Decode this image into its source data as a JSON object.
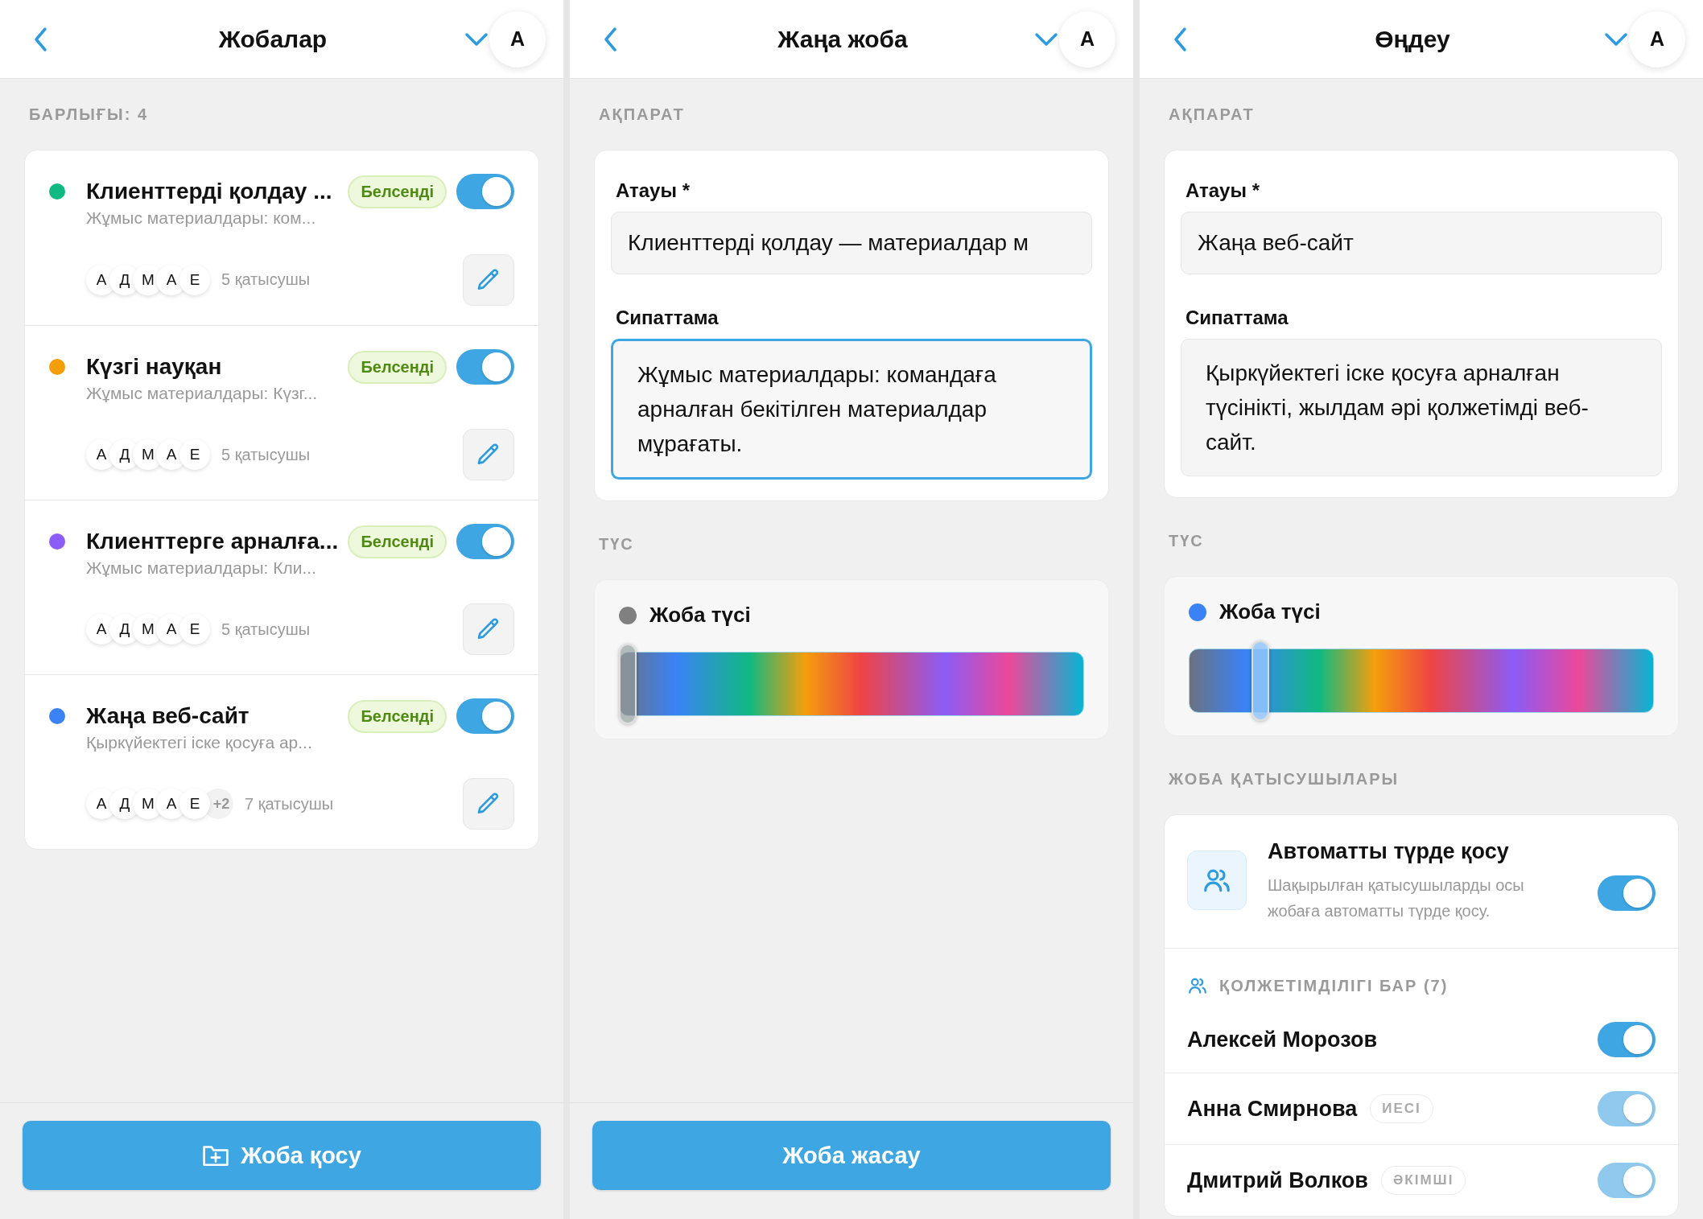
{
  "screens": [
    {
      "kind": "list",
      "header": {
        "title": "Жобалар",
        "avatar": "А"
      },
      "section_label": "БАРЛЫҒЫ: 4",
      "projects": [
        {
          "color": "#10b981",
          "title": "Клиенттерді қолдау ...",
          "description": "Жұмыс материалдары: ком...",
          "status": "Белсенді",
          "on": true,
          "avatars": [
            "А",
            "Д",
            "М",
            "А",
            "Е"
          ],
          "participants": "5 қатысушы"
        },
        {
          "color": "#f59e0b",
          "title": "Күзгі науқан",
          "description": "Жұмыс материалдары: Күзг...",
          "status": "Белсенді",
          "on": true,
          "avatars": [
            "А",
            "Д",
            "М",
            "А",
            "Е"
          ],
          "participants": "5 қатысушы"
        },
        {
          "color": "#8b5cf6",
          "title": "Клиенттерге арналға...",
          "description": "Жұмыс материалдары: Кли...",
          "status": "Белсенді",
          "on": true,
          "avatars": [
            "А",
            "Д",
            "М",
            "А",
            "Е"
          ],
          "participants": "5 қатысушы"
        },
        {
          "color": "#3b82f6",
          "title": "Жаңа веб-сайт",
          "description": "Қыркүйектегі іске қосуға ар...",
          "status": "Белсенді",
          "on": true,
          "avatars": [
            "А",
            "Д",
            "М",
            "А",
            "Е"
          ],
          "extra": "+2",
          "participants": "7 қатысушы"
        }
      ],
      "button": "Жоба қосу"
    },
    {
      "kind": "form",
      "header": {
        "title": "Жаңа жоба",
        "avatar": "А"
      },
      "info_label": "АҚПАРАТ",
      "fields": [
        {
          "kind": "input",
          "label": "Атауы *",
          "value": "Клиенттерді қолдау — материалдар м",
          "focused": false
        },
        {
          "kind": "textarea",
          "label": "Сипаттама",
          "value": "Жұмыс материалдары: командаға арналған бекітілген материалдар мұрағаты.",
          "focused": true
        }
      ],
      "color_label": "ТҮС",
      "color_picker": {
        "label": "Жоба түсі",
        "color": "#808080",
        "level": 0
      },
      "button": "Жоба жасау"
    },
    {
      "kind": "form",
      "header": {
        "title": "Өңдеу",
        "avatar": "А"
      },
      "info_label": "АҚПАРАТ",
      "fields": [
        {
          "kind": "input",
          "label": "Атауы *",
          "value": "Жаңа веб-сайт",
          "focused": false
        },
        {
          "kind": "textarea",
          "label": "Сипаттама",
          "value": "Қыркүйектегі іске қосуға арналған түсінікті, жылдам әрі қолжетімді веб-сайт.",
          "focused": false
        }
      ],
      "color_label": "ТҮС",
      "color_picker": {
        "label": "Жоба түсі",
        "color": "#3b82f6",
        "level": 0.14
      },
      "participants": {
        "label": "ЖОБА ҚАТЫСУШЫЛАРЫ",
        "auto": {
          "title": "Автоматты түрде қосу",
          "description": "Шақырылған қатысушыларды осы жобаға автоматты түрде қосу.",
          "on": true
        },
        "access_label": "ҚОЛЖЕТІМДІЛІГІ БАР (7)",
        "members": [
          {
            "name": "Алексей Морозов",
            "on": true,
            "disabled": false
          },
          {
            "name": "Анна Смирнова",
            "role": "ИЕСІ",
            "on": true,
            "disabled": true
          },
          {
            "name": "Дмитрий Волков",
            "role": "ӘКІМШІ",
            "on": true,
            "disabled": true
          }
        ]
      }
    }
  ]
}
